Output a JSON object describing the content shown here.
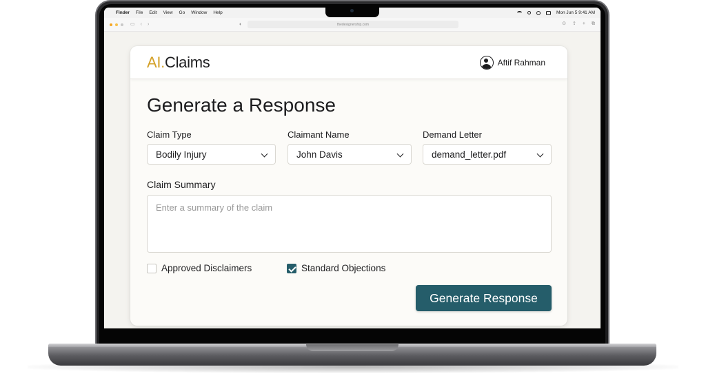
{
  "menubar": {
    "items": [
      "Finder",
      "File",
      "Edit",
      "View",
      "Go",
      "Window",
      "Help"
    ],
    "datetime": "Mon Jun 5  9:41 AM"
  },
  "browser": {
    "url": "thedesignership.com"
  },
  "app": {
    "logo_accent": "AI.",
    "logo_rest": "Claims",
    "user_name": "Aftif Rahman",
    "page_title": "Generate a Response"
  },
  "form": {
    "claim_type": {
      "label": "Claim Type",
      "value": "Bodily Injury"
    },
    "claimant_name": {
      "label": "Claimant Name",
      "value": "John Davis"
    },
    "demand_letter": {
      "label": "Demand Letter",
      "value": "demand_letter.pdf"
    },
    "claim_summary": {
      "label": "Claim Summary",
      "placeholder": "Enter a summary of the claim"
    },
    "approved_disclaimers": {
      "label": "Approved Disclaimers",
      "checked": false
    },
    "standard_objections": {
      "label": "Standard Objections",
      "checked": true
    },
    "submit_label": "Generate Response"
  },
  "colors": {
    "accent_gold": "#d4a22b",
    "primary_teal": "#255d6a",
    "page_background": "#f4f3ef"
  }
}
